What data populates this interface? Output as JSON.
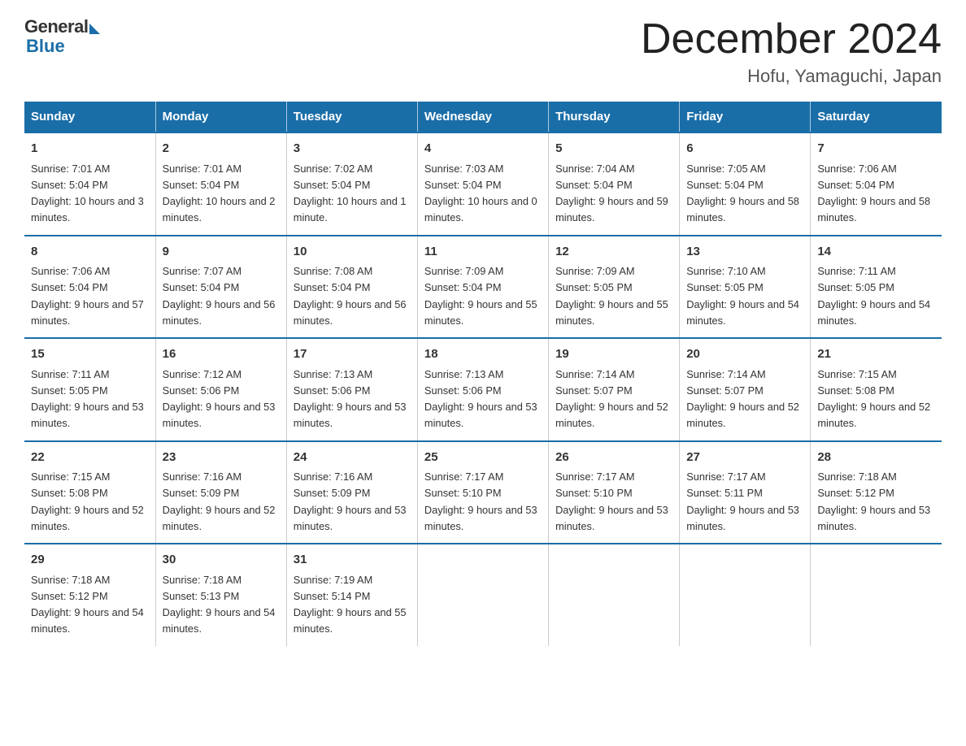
{
  "logo": {
    "general": "General",
    "blue": "Blue"
  },
  "title": {
    "month_year": "December 2024",
    "location": "Hofu, Yamaguchi, Japan"
  },
  "days_of_week": [
    "Sunday",
    "Monday",
    "Tuesday",
    "Wednesday",
    "Thursday",
    "Friday",
    "Saturday"
  ],
  "weeks": [
    [
      {
        "day": "1",
        "sunrise": "Sunrise: 7:01 AM",
        "sunset": "Sunset: 5:04 PM",
        "daylight": "Daylight: 10 hours and 3 minutes."
      },
      {
        "day": "2",
        "sunrise": "Sunrise: 7:01 AM",
        "sunset": "Sunset: 5:04 PM",
        "daylight": "Daylight: 10 hours and 2 minutes."
      },
      {
        "day": "3",
        "sunrise": "Sunrise: 7:02 AM",
        "sunset": "Sunset: 5:04 PM",
        "daylight": "Daylight: 10 hours and 1 minute."
      },
      {
        "day": "4",
        "sunrise": "Sunrise: 7:03 AM",
        "sunset": "Sunset: 5:04 PM",
        "daylight": "Daylight: 10 hours and 0 minutes."
      },
      {
        "day": "5",
        "sunrise": "Sunrise: 7:04 AM",
        "sunset": "Sunset: 5:04 PM",
        "daylight": "Daylight: 9 hours and 59 minutes."
      },
      {
        "day": "6",
        "sunrise": "Sunrise: 7:05 AM",
        "sunset": "Sunset: 5:04 PM",
        "daylight": "Daylight: 9 hours and 58 minutes."
      },
      {
        "day": "7",
        "sunrise": "Sunrise: 7:06 AM",
        "sunset": "Sunset: 5:04 PM",
        "daylight": "Daylight: 9 hours and 58 minutes."
      }
    ],
    [
      {
        "day": "8",
        "sunrise": "Sunrise: 7:06 AM",
        "sunset": "Sunset: 5:04 PM",
        "daylight": "Daylight: 9 hours and 57 minutes."
      },
      {
        "day": "9",
        "sunrise": "Sunrise: 7:07 AM",
        "sunset": "Sunset: 5:04 PM",
        "daylight": "Daylight: 9 hours and 56 minutes."
      },
      {
        "day": "10",
        "sunrise": "Sunrise: 7:08 AM",
        "sunset": "Sunset: 5:04 PM",
        "daylight": "Daylight: 9 hours and 56 minutes."
      },
      {
        "day": "11",
        "sunrise": "Sunrise: 7:09 AM",
        "sunset": "Sunset: 5:04 PM",
        "daylight": "Daylight: 9 hours and 55 minutes."
      },
      {
        "day": "12",
        "sunrise": "Sunrise: 7:09 AM",
        "sunset": "Sunset: 5:05 PM",
        "daylight": "Daylight: 9 hours and 55 minutes."
      },
      {
        "day": "13",
        "sunrise": "Sunrise: 7:10 AM",
        "sunset": "Sunset: 5:05 PM",
        "daylight": "Daylight: 9 hours and 54 minutes."
      },
      {
        "day": "14",
        "sunrise": "Sunrise: 7:11 AM",
        "sunset": "Sunset: 5:05 PM",
        "daylight": "Daylight: 9 hours and 54 minutes."
      }
    ],
    [
      {
        "day": "15",
        "sunrise": "Sunrise: 7:11 AM",
        "sunset": "Sunset: 5:05 PM",
        "daylight": "Daylight: 9 hours and 53 minutes."
      },
      {
        "day": "16",
        "sunrise": "Sunrise: 7:12 AM",
        "sunset": "Sunset: 5:06 PM",
        "daylight": "Daylight: 9 hours and 53 minutes."
      },
      {
        "day": "17",
        "sunrise": "Sunrise: 7:13 AM",
        "sunset": "Sunset: 5:06 PM",
        "daylight": "Daylight: 9 hours and 53 minutes."
      },
      {
        "day": "18",
        "sunrise": "Sunrise: 7:13 AM",
        "sunset": "Sunset: 5:06 PM",
        "daylight": "Daylight: 9 hours and 53 minutes."
      },
      {
        "day": "19",
        "sunrise": "Sunrise: 7:14 AM",
        "sunset": "Sunset: 5:07 PM",
        "daylight": "Daylight: 9 hours and 52 minutes."
      },
      {
        "day": "20",
        "sunrise": "Sunrise: 7:14 AM",
        "sunset": "Sunset: 5:07 PM",
        "daylight": "Daylight: 9 hours and 52 minutes."
      },
      {
        "day": "21",
        "sunrise": "Sunrise: 7:15 AM",
        "sunset": "Sunset: 5:08 PM",
        "daylight": "Daylight: 9 hours and 52 minutes."
      }
    ],
    [
      {
        "day": "22",
        "sunrise": "Sunrise: 7:15 AM",
        "sunset": "Sunset: 5:08 PM",
        "daylight": "Daylight: 9 hours and 52 minutes."
      },
      {
        "day": "23",
        "sunrise": "Sunrise: 7:16 AM",
        "sunset": "Sunset: 5:09 PM",
        "daylight": "Daylight: 9 hours and 52 minutes."
      },
      {
        "day": "24",
        "sunrise": "Sunrise: 7:16 AM",
        "sunset": "Sunset: 5:09 PM",
        "daylight": "Daylight: 9 hours and 53 minutes."
      },
      {
        "day": "25",
        "sunrise": "Sunrise: 7:17 AM",
        "sunset": "Sunset: 5:10 PM",
        "daylight": "Daylight: 9 hours and 53 minutes."
      },
      {
        "day": "26",
        "sunrise": "Sunrise: 7:17 AM",
        "sunset": "Sunset: 5:10 PM",
        "daylight": "Daylight: 9 hours and 53 minutes."
      },
      {
        "day": "27",
        "sunrise": "Sunrise: 7:17 AM",
        "sunset": "Sunset: 5:11 PM",
        "daylight": "Daylight: 9 hours and 53 minutes."
      },
      {
        "day": "28",
        "sunrise": "Sunrise: 7:18 AM",
        "sunset": "Sunset: 5:12 PM",
        "daylight": "Daylight: 9 hours and 53 minutes."
      }
    ],
    [
      {
        "day": "29",
        "sunrise": "Sunrise: 7:18 AM",
        "sunset": "Sunset: 5:12 PM",
        "daylight": "Daylight: 9 hours and 54 minutes."
      },
      {
        "day": "30",
        "sunrise": "Sunrise: 7:18 AM",
        "sunset": "Sunset: 5:13 PM",
        "daylight": "Daylight: 9 hours and 54 minutes."
      },
      {
        "day": "31",
        "sunrise": "Sunrise: 7:19 AM",
        "sunset": "Sunset: 5:14 PM",
        "daylight": "Daylight: 9 hours and 55 minutes."
      },
      {
        "day": "",
        "sunrise": "",
        "sunset": "",
        "daylight": ""
      },
      {
        "day": "",
        "sunrise": "",
        "sunset": "",
        "daylight": ""
      },
      {
        "day": "",
        "sunrise": "",
        "sunset": "",
        "daylight": ""
      },
      {
        "day": "",
        "sunrise": "",
        "sunset": "",
        "daylight": ""
      }
    ]
  ]
}
